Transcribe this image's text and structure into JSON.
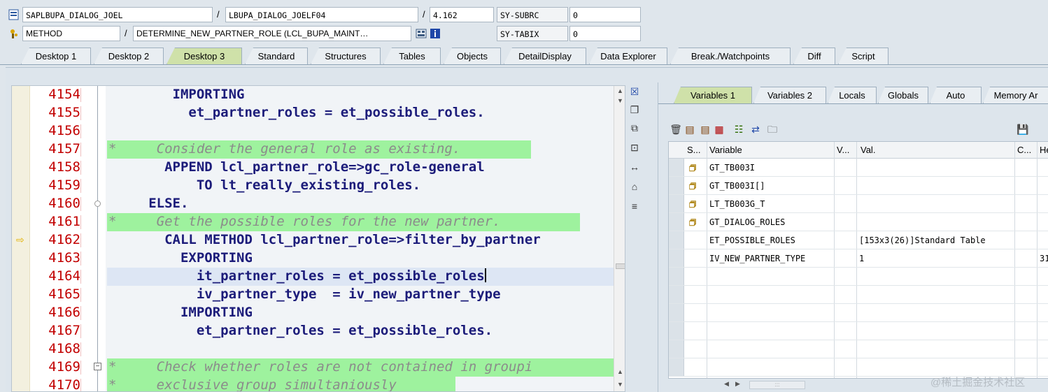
{
  "header": {
    "row1": {
      "program": "SAPLBUPA_DIALOG_JOEL",
      "include": "LBUPA_DIALOG_JOELF04",
      "line": "4.162",
      "sysfield_label": "SY-SUBRC",
      "sysfield_value": "0"
    },
    "row2": {
      "event_type": "METHOD",
      "event_name": "DETERMINE_NEW_PARTNER_ROLE (LCL_BUPA_MAINT…",
      "sysfield_label": "SY-TABIX",
      "sysfield_value": "0"
    }
  },
  "desktop_tabs": [
    "Desktop 1",
    "Desktop 2",
    "Desktop 3",
    "Standard",
    "Structures",
    "Tables",
    "Objects",
    "DetailDisplay",
    "Data Explorer",
    "Break./Watchpoints",
    "Diff",
    "Script"
  ],
  "active_desktop_tab": "Desktop 3",
  "code": {
    "lines": [
      {
        "no": "4154",
        "text": "        IMPORTING"
      },
      {
        "no": "4155",
        "text": "          et_partner_roles = et_possible_roles."
      },
      {
        "no": "4156",
        "text": ""
      },
      {
        "no": "4157",
        "text": "*     Consider the general role as existing."
      },
      {
        "no": "4158",
        "text": "       APPEND lcl_partner_role=>gc_role-general"
      },
      {
        "no": "4159",
        "text": "           TO lt_really_existing_roles."
      },
      {
        "no": "4160",
        "text": "     ELSE."
      },
      {
        "no": "4161",
        "text": "*     Get the possible roles for the new partner."
      },
      {
        "no": "4162",
        "text": "       CALL METHOD lcl_partner_role=>filter_by_partner"
      },
      {
        "no": "4163",
        "text": "         EXPORTING"
      },
      {
        "no": "4164",
        "text": "           it_partner_roles = et_possible_roles"
      },
      {
        "no": "4165",
        "text": "           iv_partner_type  = iv_new_partner_type"
      },
      {
        "no": "4166",
        "text": "         IMPORTING"
      },
      {
        "no": "4167",
        "text": "           et_partner_roles = et_possible_roles."
      },
      {
        "no": "4168",
        "text": ""
      },
      {
        "no": "4169",
        "text": "*     Check whether roles are not contained in groupi"
      },
      {
        "no": "4170",
        "text": "*     exclusive group simultaniously"
      }
    ]
  },
  "variables_tabs": [
    "Variables 1",
    "Variables 2",
    "Locals",
    "Globals",
    "Auto",
    "Memory Ar"
  ],
  "active_variables_tab": "Variables 1",
  "variables_grid": {
    "headers": [
      "S...",
      "Variable",
      "V...",
      "Val.",
      "C...",
      "He"
    ],
    "rows": [
      {
        "icon": true,
        "variable": "GT_TB003I",
        "value": "",
        "extra": ""
      },
      {
        "icon": true,
        "variable": "GT_TB003I[]",
        "value": "",
        "extra": ""
      },
      {
        "icon": true,
        "variable": "LT_TB003G_T",
        "value": "",
        "extra": ""
      },
      {
        "icon": true,
        "variable": "GT_DIALOG_ROLES",
        "value": "",
        "extra": ""
      },
      {
        "icon": false,
        "variable": "ET_POSSIBLE_ROLES",
        "value": "[153x3(26)]Standard Table",
        "extra": ""
      },
      {
        "icon": false,
        "variable": "IV_NEW_PARTNER_TYPE",
        "value": "1",
        "extra": "31"
      }
    ]
  },
  "watermark": "@稀土掘金技术社区"
}
